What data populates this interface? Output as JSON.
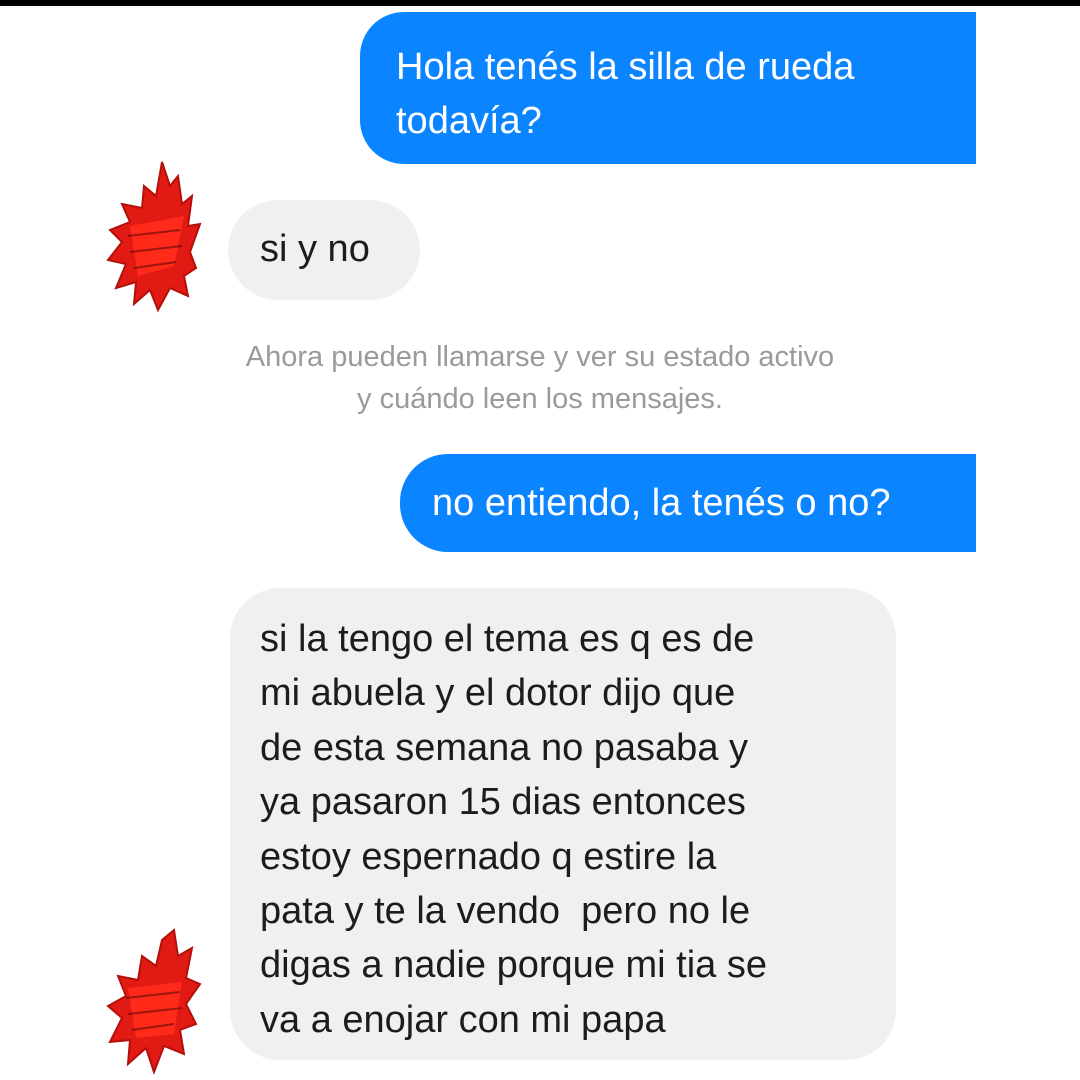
{
  "conversation": {
    "messages": [
      {
        "sender": "me",
        "text": "Hola tenés la silla de rueda\ntodavía?"
      },
      {
        "sender": "other",
        "text": "si y no"
      },
      {
        "sender": "me",
        "text": "no entiendo, la tenés o no?"
      },
      {
        "sender": "other",
        "text": "si la tengo el tema es q es de\nmi abuela y el dotor dijo que\nde esta semana no pasaba y\nya pasaron 15 dias entonces\nestoy espernado q estire la\npata y te la vendo  pero no le\ndigas a nadie porque mi tia se\nva a enojar con mi papa"
      }
    ],
    "notice": "Ahora pueden llamarse y ver su estado activo\ny cuándo leen los mensajes."
  },
  "colors": {
    "sent_bubble": "#0a84ff",
    "received_bubble": "#eef0f2",
    "avatar_scribble": "#e21a14"
  },
  "icons": {
    "avatar": "red-scribble-censored-avatar"
  }
}
